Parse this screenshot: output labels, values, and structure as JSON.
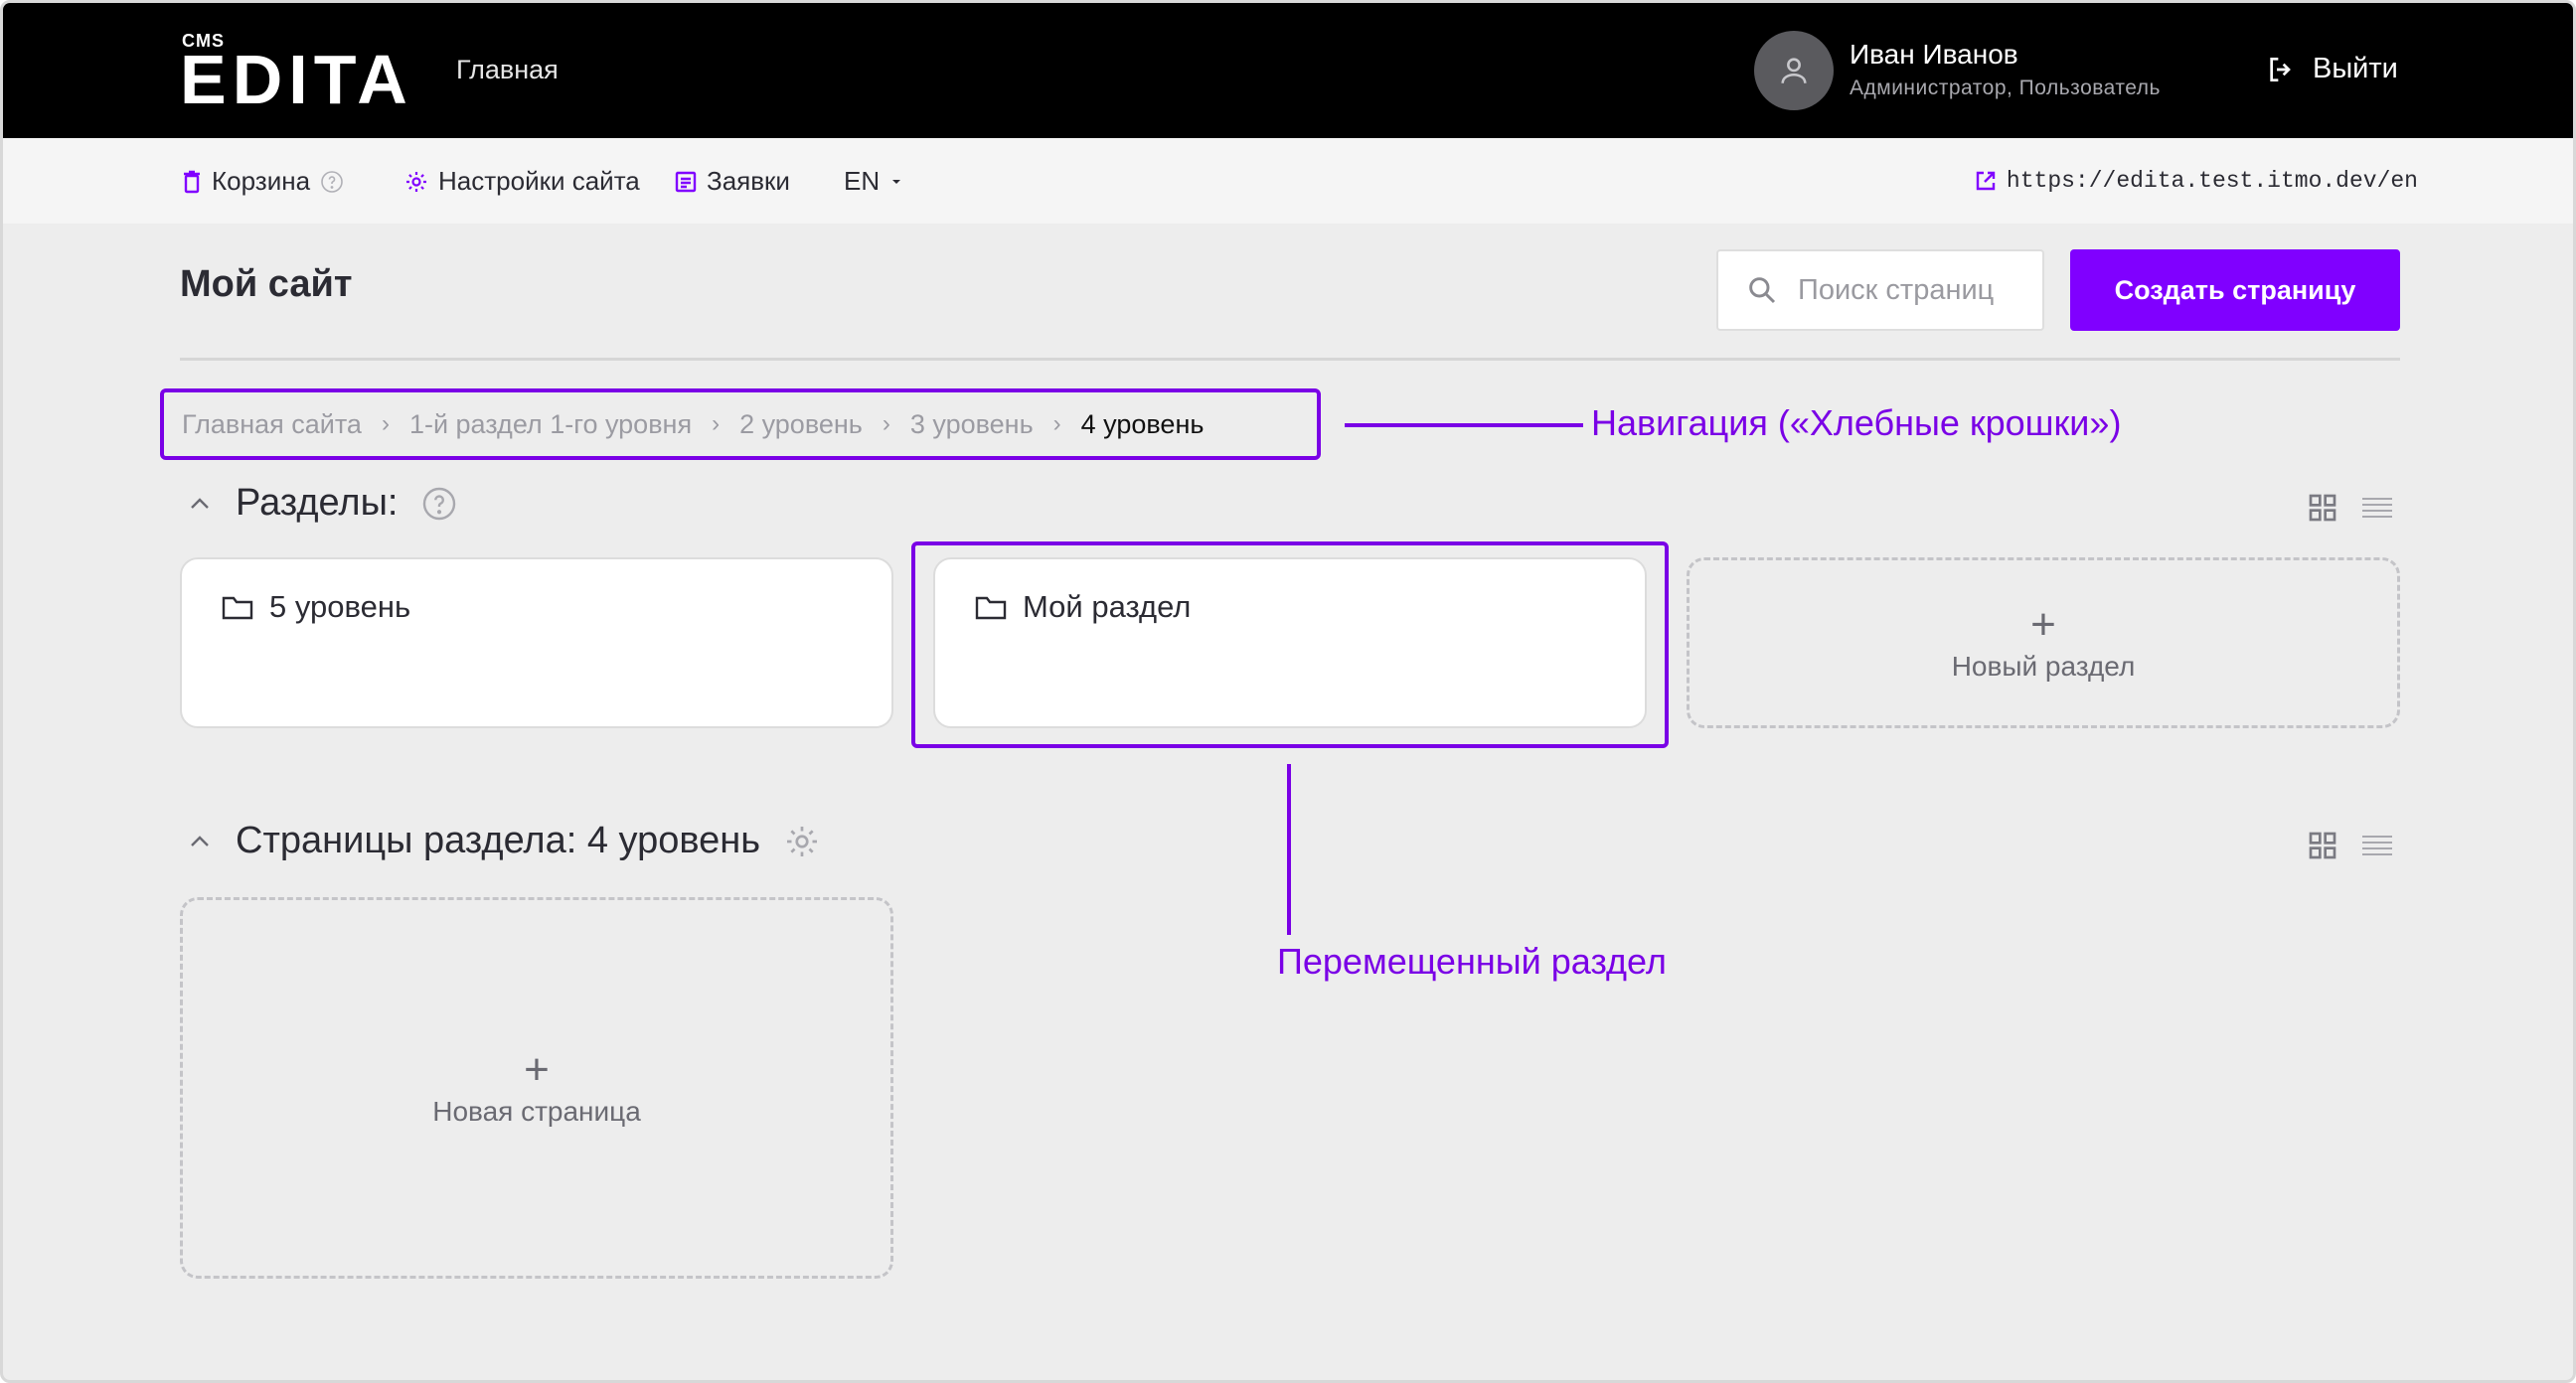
{
  "header": {
    "logo_small": "CMS",
    "logo": "EDITA",
    "nav_home": "Главная",
    "user_name": "Иван Иванов",
    "user_role": "Администратор, Пользователь",
    "logout_label": "Выйти"
  },
  "subbar": {
    "trash": "Корзина",
    "settings": "Настройки сайта",
    "requests": "Заявки",
    "language": "EN",
    "site_url": "https://edita.test.itmo.dev/en"
  },
  "page": {
    "title": "Мой сайт",
    "search_placeholder": "Поиск страниц",
    "create_button": "Создать страницу"
  },
  "breadcrumbs": [
    "Главная сайта",
    "1-й раздел 1-го уровня",
    "2 уровень",
    "3 уровень",
    "4 уровень"
  ],
  "annotations": {
    "breadcrumbs": "Навигация («Хлебные крошки»)",
    "moved_section": "Перемещенный раздел"
  },
  "sections": {
    "title": "Разделы:",
    "cards": [
      "5 уровень",
      "Мой раздел"
    ],
    "new_section": "Новый раздел"
  },
  "pages_block": {
    "title": "Страницы раздела: 4 уровень",
    "new_page": "Новая страница"
  },
  "colors": {
    "accent": "#8000ff",
    "annotation": "#7a00e6",
    "topbar": "#000000",
    "background": "#ededed"
  }
}
